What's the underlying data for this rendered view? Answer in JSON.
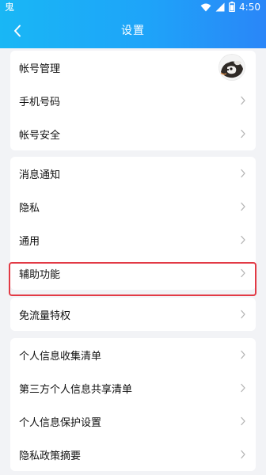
{
  "status_bar": {
    "app_glyph": "鬼",
    "time": "4:50"
  },
  "nav": {
    "title": "设置"
  },
  "groups": [
    {
      "items": [
        {
          "label": "帐号管理",
          "trailing": "avatar"
        },
        {
          "label": "手机号码",
          "trailing": "chevron"
        },
        {
          "label": "帐号安全",
          "trailing": "chevron"
        }
      ]
    },
    {
      "items": [
        {
          "label": "消息通知",
          "trailing": "chevron"
        },
        {
          "label": "隐私",
          "trailing": "chevron"
        },
        {
          "label": "通用",
          "trailing": "chevron"
        },
        {
          "label": "辅助功能",
          "trailing": "chevron",
          "highlighted": true
        }
      ]
    },
    {
      "items": [
        {
          "label": "免流量特权",
          "trailing": "chevron"
        }
      ]
    },
    {
      "items": [
        {
          "label": "个人信息收集清单",
          "trailing": "chevron"
        },
        {
          "label": "第三方个人信息共享清单",
          "trailing": "chevron"
        },
        {
          "label": "个人信息保护设置",
          "trailing": "chevron"
        },
        {
          "label": "隐私政策摘要",
          "trailing": "chevron"
        }
      ]
    }
  ],
  "colors": {
    "header_start": "#19b7f5",
    "header_end": "#2a86f8",
    "background": "#f2f3f6",
    "highlight": "#e23a45",
    "chevron": "#b4b4b4"
  },
  "icons": {
    "back": "chevron-left-icon",
    "row_trailing": "chevron-right-icon",
    "status": [
      "wifi-icon",
      "signal-icon",
      "battery-icon"
    ]
  }
}
